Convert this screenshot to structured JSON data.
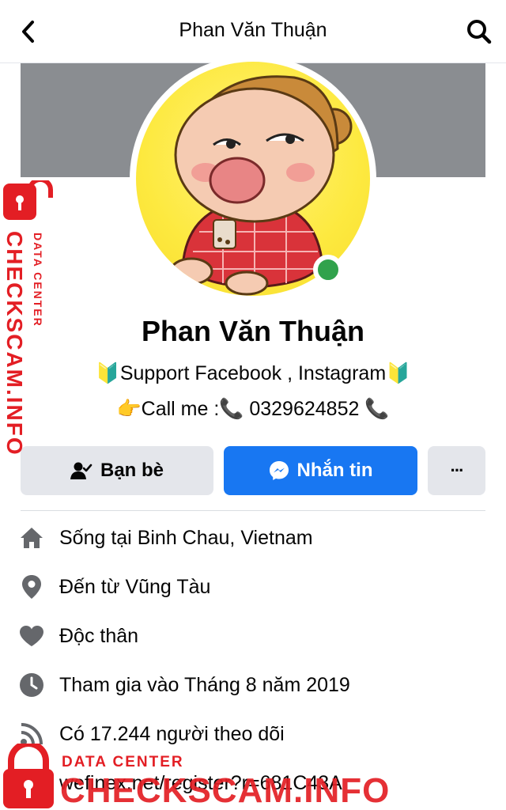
{
  "header": {
    "title": "Phan Văn Thuận",
    "back_icon": "chevron-left-icon",
    "search_icon": "search-icon"
  },
  "profile": {
    "name": "Phan Văn Thuận",
    "bio_line1": "🔰Support Facebook , Instagram🔰",
    "bio_line2": "👉Call me :📞 0329624852 📞",
    "online": true
  },
  "actions": {
    "friends_label": "Bạn bè",
    "message_label": "Nhắn tin",
    "more_label": "···"
  },
  "details": [
    {
      "icon": "home-icon",
      "prefix": "Sống tại ",
      "value": "Binh Chau, Vietnam"
    },
    {
      "icon": "location-pin-icon",
      "prefix": "Đến từ ",
      "value": "Vũng Tàu"
    },
    {
      "icon": "heart-icon",
      "prefix": "Độc thân",
      "value": ""
    },
    {
      "icon": "clock-icon",
      "prefix": "Tham gia vào Tháng 8 năm 2019",
      "value": ""
    },
    {
      "icon": "rss-icon",
      "prefix": "Có 17.244 người theo dõi",
      "value": ""
    },
    {
      "icon": "",
      "prefix": "wefinex.net/register?r=681C43A",
      "value": ""
    }
  ],
  "watermark": {
    "small": "DATA CENTER",
    "big": "CHECKSCAM.INFO"
  },
  "colors": {
    "accent": "#1877f2",
    "watermark": "#e31e24",
    "online": "#31a24c",
    "icon_gray": "#65676b"
  }
}
